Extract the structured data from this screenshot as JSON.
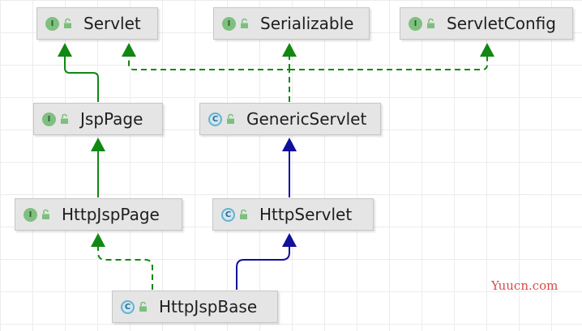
{
  "nodes": [
    {
      "id": "Servlet",
      "label": "Servlet",
      "kind": "interface",
      "badge": "I"
    },
    {
      "id": "Serializable",
      "label": "Serializable",
      "kind": "interface",
      "badge": "I"
    },
    {
      "id": "ServletConfig",
      "label": "ServletConfig",
      "kind": "interface",
      "badge": "I"
    },
    {
      "id": "JspPage",
      "label": "JspPage",
      "kind": "interface",
      "badge": "I"
    },
    {
      "id": "GenericServlet",
      "label": "GenericServlet",
      "kind": "class",
      "badge": "C"
    },
    {
      "id": "HttpJspPage",
      "label": "HttpJspPage",
      "kind": "interface",
      "badge": "I"
    },
    {
      "id": "HttpServlet",
      "label": "HttpServlet",
      "kind": "class",
      "badge": "C"
    },
    {
      "id": "HttpJspBase",
      "label": "HttpJspBase",
      "kind": "class",
      "badge": "C"
    }
  ],
  "edges": [
    {
      "from": "JspPage",
      "to": "Servlet",
      "relation": "extends-interface",
      "style": "solid",
      "color": "#118811"
    },
    {
      "from": "HttpJspPage",
      "to": "JspPage",
      "relation": "extends-interface",
      "style": "solid",
      "color": "#118811"
    },
    {
      "from": "GenericServlet",
      "to": "Servlet",
      "relation": "implements",
      "style": "dashed",
      "color": "#118811"
    },
    {
      "from": "GenericServlet",
      "to": "Serializable",
      "relation": "implements",
      "style": "dashed",
      "color": "#118811"
    },
    {
      "from": "GenericServlet",
      "to": "ServletConfig",
      "relation": "implements",
      "style": "dashed",
      "color": "#118811"
    },
    {
      "from": "HttpServlet",
      "to": "GenericServlet",
      "relation": "extends",
      "style": "solid",
      "color": "#10109a"
    },
    {
      "from": "HttpJspBase",
      "to": "HttpServlet",
      "relation": "extends",
      "style": "solid",
      "color": "#10109a"
    },
    {
      "from": "HttpJspBase",
      "to": "HttpJspPage",
      "relation": "implements",
      "style": "dashed",
      "color": "#118811"
    }
  ],
  "colors": {
    "implements": "#118811",
    "extends_class": "#10109a",
    "node_fill": "#e5e5e5",
    "watermark": "#d94a4a"
  },
  "watermark": "Yuucn.com"
}
